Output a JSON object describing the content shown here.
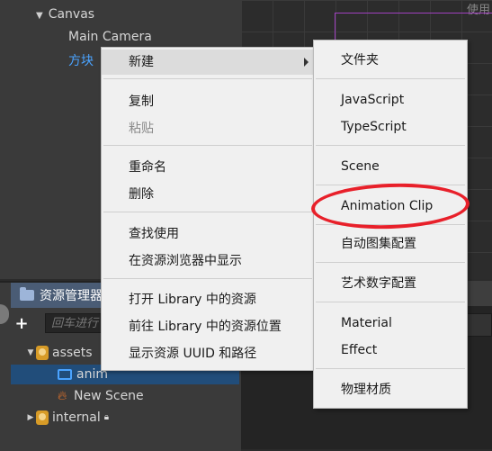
{
  "hierarchy": {
    "canvas": "Canvas",
    "main_camera": "Main Camera",
    "block": "方块"
  },
  "scene": {
    "tag": "使用"
  },
  "assets": {
    "title": "资源管理器",
    "search_placeholder": "回车进行",
    "tree": [
      {
        "label": "assets"
      },
      {
        "label": "anim"
      },
      {
        "label": "New Scene"
      },
      {
        "label": "internal"
      }
    ]
  },
  "context_menu": {
    "new": "新建",
    "copy": "复制",
    "paste": "粘贴",
    "rename": "重命名",
    "delete": "删除",
    "find_usage": "查找使用",
    "show_in_explorer": "在资源浏览器中显示",
    "open_in_library": "打开 Library 中的资源",
    "goto_library": "前往 Library 中的资源位置",
    "show_uuid": "显示资源 UUID 和路径"
  },
  "submenu": {
    "folder": "文件夹",
    "javascript": "JavaScript",
    "typescript": "TypeScript",
    "scene": "Scene",
    "animation_clip": "Animation Clip",
    "auto_atlas": "自动图集配置",
    "art_number": "艺术数字配置",
    "material": "Material",
    "effect": "Effect",
    "physics_material": "物理材质"
  }
}
